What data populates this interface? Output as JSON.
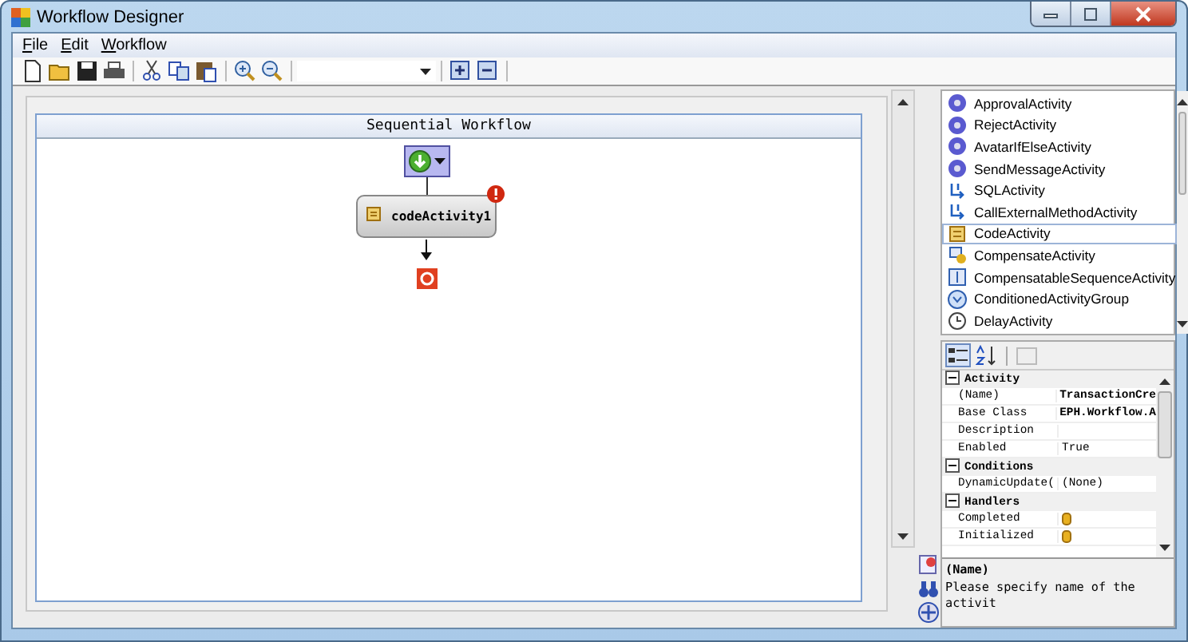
{
  "window": {
    "title": "Workflow Designer"
  },
  "menu": [
    {
      "label": "File"
    },
    {
      "label": "Edit"
    },
    {
      "label": "Workflow"
    }
  ],
  "designer": {
    "title": "Sequential Workflow",
    "activity": {
      "label": "codeActivity1",
      "has_error": true
    }
  },
  "toolbox": [
    {
      "label": "ApprovalActivity",
      "kind": "gear",
      "selected": false
    },
    {
      "label": "RejectActivity",
      "kind": "gear",
      "selected": false
    },
    {
      "label": "AvatarIfElseActivity",
      "kind": "gear",
      "selected": false
    },
    {
      "label": "SendMessageActivity",
      "kind": "gear",
      "selected": false
    },
    {
      "label": "SQLActivity",
      "kind": "plug",
      "selected": false
    },
    {
      "label": "CallExternalMethodActivity",
      "kind": "plug",
      "selected": false
    },
    {
      "label": "CodeActivity",
      "kind": "scroll",
      "selected": true
    },
    {
      "label": "CompensateActivity",
      "kind": "compensate",
      "selected": false
    },
    {
      "label": "CompensatableSequenceActivity",
      "kind": "sequence",
      "selected": false
    },
    {
      "label": "ConditionedActivityGroup",
      "kind": "condition",
      "selected": false
    },
    {
      "label": "DelayActivity",
      "kind": "clock",
      "selected": false
    }
  ],
  "properties": {
    "categories": [
      {
        "label": "Activity",
        "expanded": true,
        "rows": [
          {
            "name": "(Name)",
            "value": "TransactionCre",
            "bold": true
          },
          {
            "name": "Base Class",
            "value": "EPH.Workflow.A",
            "bold": true
          },
          {
            "name": "Description"
          },
          {
            "name": "Enabled",
            "value": "True",
            "bold": false
          }
        ]
      },
      {
        "label": "Conditions",
        "expanded": true,
        "rows": [
          {
            "name": "DynamicUpdate(",
            "value": "(None)",
            "bold": false
          }
        ]
      },
      {
        "label": "Handlers",
        "expanded": true,
        "rows": [
          {
            "name": "Completed",
            "kind": "event"
          },
          {
            "name": "Initialized",
            "kind": "event"
          }
        ]
      }
    ],
    "description": {
      "title": "(Name)",
      "text": "Please specify name of the activit"
    }
  }
}
